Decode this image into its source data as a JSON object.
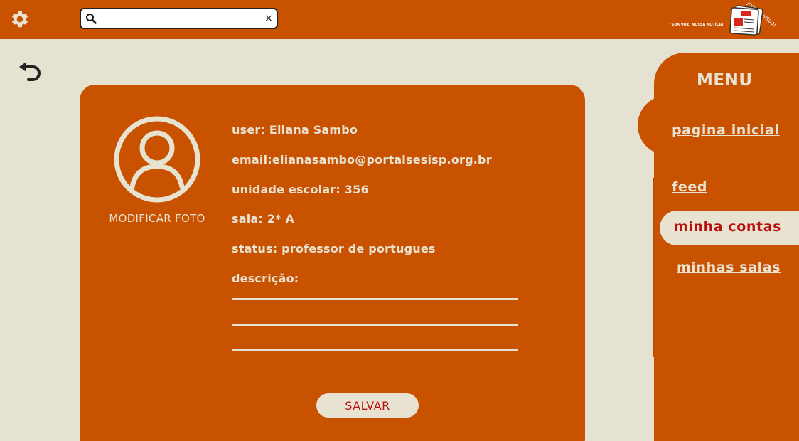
{
  "header": {
    "search": {
      "value": "",
      "placeholder": ""
    },
    "clear_label": "×",
    "logo": {
      "slogan": "\"SUA VOZ, NOSSA NOTÍCIA\"",
      "brand": "jornal virtual"
    }
  },
  "profile": {
    "modify_photo_label": "MODIFICAR FOTO",
    "user": "user: Eliana Sambo",
    "email": "email:elianasambo@portalsesisp.org.br",
    "school_unit": "unidade escolar: 356",
    "room": "sala: 2* A",
    "status": "status: professor de portugues",
    "description_label": "descrição:",
    "save_label": "SALVAR"
  },
  "menu": {
    "title": "MENU",
    "items": [
      {
        "label": "pagina inicial",
        "selected": false
      },
      {
        "label": "feed",
        "selected": false
      },
      {
        "label": "minha contas",
        "selected": true
      },
      {
        "label": "minhas salas",
        "selected": false
      }
    ]
  },
  "colors": {
    "primary": "#c85200",
    "background": "#e5e2d1",
    "cream": "#e8e2d1",
    "accent_red": "#b80f0f"
  },
  "icons": {
    "settings": "gear-icon",
    "search": "search-icon",
    "back": "undo-arrow-icon",
    "avatar": "user-avatar-icon",
    "logo": "newspaper-icon"
  }
}
